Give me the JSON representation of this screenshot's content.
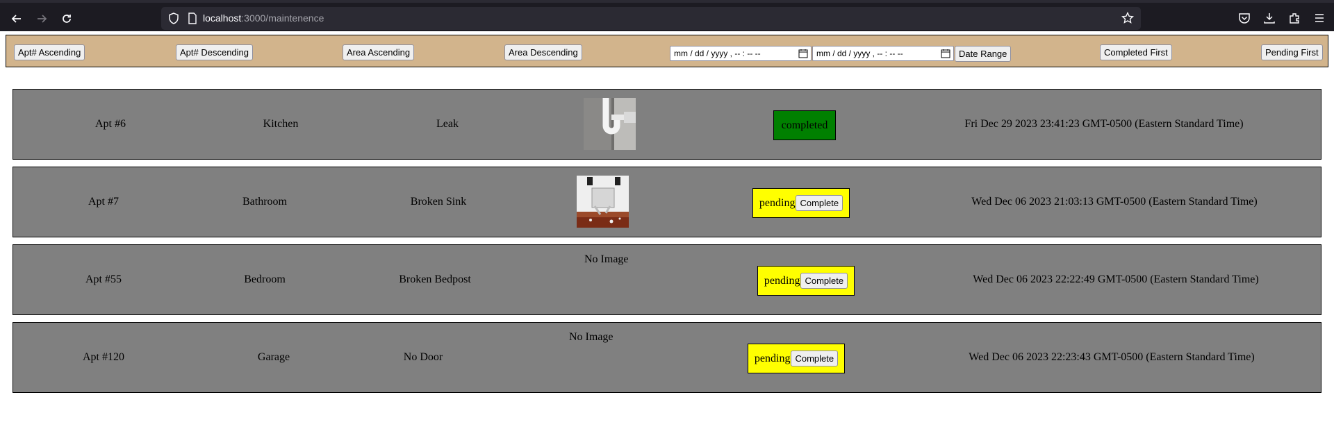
{
  "browser": {
    "url_host": "localhost",
    "url_rest": ":3000/maintenence"
  },
  "filters": {
    "apt_asc": "Apt# Ascending",
    "apt_desc": "Apt# Descending",
    "area_asc": "Area Ascending",
    "area_desc": "Area Descending",
    "date_start": "mm / dd / yyyy ,  -- : --   --",
    "date_end": "mm / dd / yyyy ,  -- : --   --",
    "date_range": "Date Range",
    "completed_first": "Completed First",
    "pending_first": "Pending First"
  },
  "requests": [
    {
      "apt": "Apt #6",
      "area": "Kitchen",
      "issue": "Leak",
      "image": "pipe-photo",
      "status": "completed",
      "date": "Fri Dec 29 2023 23:41:23 GMT-0500 (Eastern Standard Time)"
    },
    {
      "apt": "Apt #7",
      "area": "Bathroom",
      "issue": "Broken Sink",
      "image": "broken-sink-photo",
      "status": "pending",
      "complete_label": "Complete",
      "date": "Wed Dec 06 2023 21:03:13 GMT-0500 (Eastern Standard Time)"
    },
    {
      "apt": "Apt #55",
      "area": "Bedroom",
      "issue": "Broken Bedpost",
      "no_image": "No Image",
      "status": "pending",
      "complete_label": "Complete",
      "date": "Wed Dec 06 2023 22:22:49 GMT-0500 (Eastern Standard Time)"
    },
    {
      "apt": "Apt #120",
      "area": "Garage",
      "issue": "No Door",
      "no_image": "No Image",
      "status": "pending",
      "complete_label": "Complete",
      "date": "Wed Dec 06 2023 22:23:43 GMT-0500 (Eastern Standard Time)"
    }
  ],
  "colors": {
    "toolbar": "#d2b48c",
    "row": "#808080",
    "completed": "#008000",
    "pending": "#ffff00"
  }
}
